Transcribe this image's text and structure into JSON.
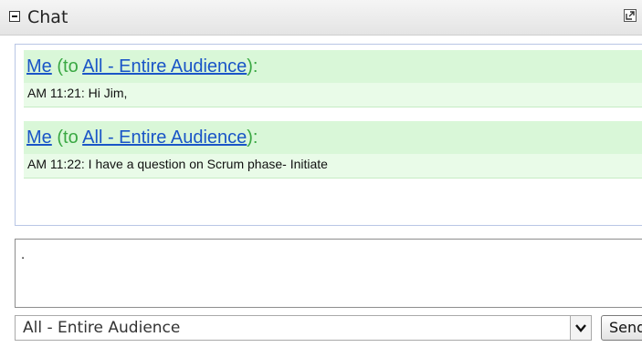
{
  "window": {
    "title": "Chat",
    "collapse_icon": "collapse-minus-icon",
    "popout_icon": "popout-window-icon"
  },
  "messages": [
    {
      "sender": "Me",
      "to_prefix": " (to ",
      "recipient": "All - Entire Audience",
      "suffix": "):",
      "time": "AM 11:21",
      "text": "Hi Jim,"
    },
    {
      "sender": "Me",
      "to_prefix": " (to ",
      "recipient": "All - Entire Audience",
      "suffix": "):",
      "time": "AM 11:22",
      "text": "I have a question on Scrum phase- Initiate"
    }
  ],
  "input": {
    "value": "."
  },
  "audience": {
    "selected": "All - Entire Audience",
    "dropdown_icon": "chevron-down-icon"
  },
  "send_label": "Send",
  "colors": {
    "message_bg": "#d9f7d8",
    "message_body_bg": "#e9fbe8",
    "link_blue": "#1a55c7",
    "to_green": "#3aa843",
    "border_blue": "#b9c6e5"
  }
}
